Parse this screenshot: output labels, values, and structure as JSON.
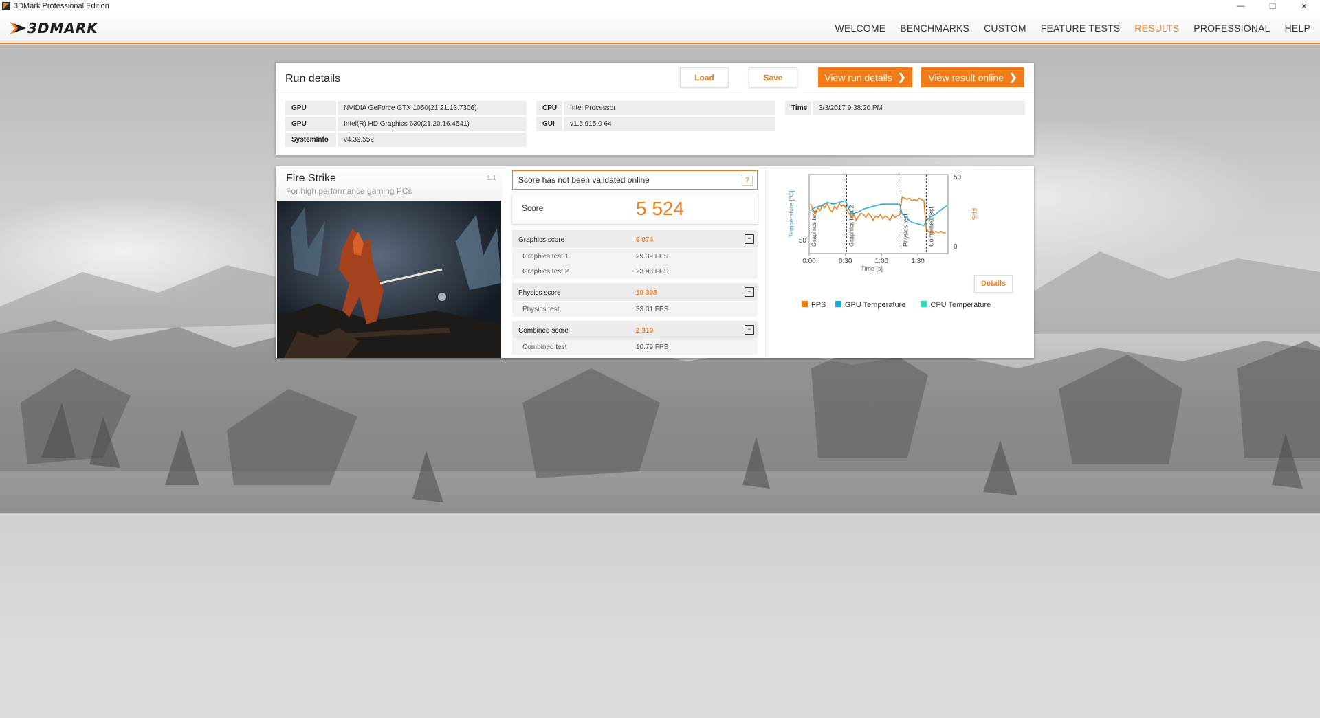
{
  "window": {
    "title": "3DMark Professional Edition",
    "minimize": "—",
    "restore": "❐",
    "close": "✕"
  },
  "nav": {
    "logo": "3DMARK",
    "items": [
      {
        "label": "WELCOME",
        "active": false
      },
      {
        "label": "BENCHMARKS",
        "active": false
      },
      {
        "label": "CUSTOM",
        "active": false
      },
      {
        "label": "FEATURE TESTS",
        "active": false
      },
      {
        "label": "RESULTS",
        "active": true
      },
      {
        "label": "PROFESSIONAL",
        "active": false
      },
      {
        "label": "HELP",
        "active": false
      }
    ]
  },
  "run_details": {
    "title": "Run details",
    "load_label": "Load",
    "save_label": "Save",
    "view_run_label": "View run details",
    "view_online_label": "View result online",
    "chevron": "❯",
    "gpu_key": "GPU",
    "gpu1": "NVIDIA GeForce GTX 1050(21.21.13.7306)",
    "gpu2": "Intel(R) HD Graphics 630(21.20.16.4541)",
    "sysinfo_key": "SystemInfo",
    "sysinfo": "v4.39.552",
    "cpu_key": "CPU",
    "cpu": "Intel Processor",
    "gui_key": "GUI",
    "gui": "v1.5.915.0 64",
    "time_key": "Time",
    "time": "3/3/2017 9:38:20 PM"
  },
  "benchmark": {
    "name": "Fire Strike",
    "subtitle": "For high performance gaming PCs",
    "version": "1.1",
    "validation": "Score has not been validated online",
    "help": "?",
    "score_label": "Score",
    "score": "5 524",
    "toggle": "−",
    "graphics_label": "Graphics score",
    "graphics_score": "6 074",
    "gt1_label": "Graphics test 1",
    "gt1_value": "29.39 FPS",
    "gt2_label": "Graphics test 2",
    "gt2_value": "23.98 FPS",
    "physics_label": "Physics score",
    "physics_score": "10 398",
    "pt_label": "Physics test",
    "pt_value": "33.01 FPS",
    "combined_label": "Combined score",
    "combined_score": "2 319",
    "ct_label": "Combined test",
    "ct_value": "10.79 FPS"
  },
  "chart_data": {
    "type": "line",
    "xlabel": "Time [s]",
    "ylabel_left": "Temperature [°C]",
    "ylabel_right": "FPS",
    "x_ticks": [
      "0:00",
      "0:30",
      "1:00",
      "1:30"
    ],
    "y_left_ticks": [
      "50"
    ],
    "y_right_ticks": [
      "50",
      "0"
    ],
    "xlim": [
      0,
      115
    ],
    "ylim_right": [
      -5,
      52
    ],
    "ylim_left": [
      42,
      90
    ],
    "sections": [
      {
        "label": "Graphics test",
        "start": 0,
        "end": 31
      },
      {
        "label": "Graphics test 2",
        "start": 31,
        "end": 76
      },
      {
        "label": "Physics test",
        "start": 76,
        "end": 97
      },
      {
        "label": "Combined test",
        "start": 97,
        "end": 115
      }
    ],
    "series": [
      {
        "name": "FPS",
        "color": "#f07d1a",
        "points": [
          [
            1,
            31
          ],
          [
            3,
            27
          ],
          [
            5,
            23
          ],
          [
            7,
            28
          ],
          [
            9,
            26
          ],
          [
            11,
            30
          ],
          [
            13,
            28
          ],
          [
            15,
            31
          ],
          [
            17,
            27
          ],
          [
            19,
            25
          ],
          [
            21,
            29
          ],
          [
            23,
            27
          ],
          [
            25,
            31
          ],
          [
            27,
            29
          ],
          [
            29,
            30
          ],
          [
            31,
            27
          ],
          [
            33,
            24
          ],
          [
            35,
            21
          ],
          [
            37,
            23
          ],
          [
            39,
            19
          ],
          [
            41,
            22
          ],
          [
            43,
            24
          ],
          [
            45,
            23
          ],
          [
            47,
            21
          ],
          [
            49,
            24
          ],
          [
            51,
            22
          ],
          [
            53,
            19
          ],
          [
            55,
            22
          ],
          [
            57,
            21
          ],
          [
            59,
            23
          ],
          [
            61,
            20
          ],
          [
            63,
            22
          ],
          [
            65,
            21
          ],
          [
            67,
            19
          ],
          [
            69,
            23
          ],
          [
            71,
            21
          ],
          [
            73,
            22
          ],
          [
            75,
            23
          ],
          [
            77,
            36
          ],
          [
            79,
            35
          ],
          [
            81,
            34
          ],
          [
            83,
            35
          ],
          [
            85,
            33
          ],
          [
            87,
            34
          ],
          [
            89,
            33
          ],
          [
            91,
            35
          ],
          [
            93,
            34
          ],
          [
            95,
            33
          ],
          [
            97,
            12
          ],
          [
            99,
            11
          ],
          [
            101,
            11
          ],
          [
            103,
            10
          ],
          [
            105,
            11
          ],
          [
            107,
            10
          ],
          [
            109,
            11
          ],
          [
            111,
            10
          ],
          [
            113,
            10
          ]
        ]
      },
      {
        "name": "GPU Temperature",
        "color": "#1ea7e1",
        "points": [
          [
            1,
            68
          ],
          [
            5,
            70
          ],
          [
            10,
            71
          ],
          [
            15,
            73
          ],
          [
            20,
            72
          ],
          [
            25,
            73
          ],
          [
            30,
            74
          ],
          [
            35,
            66
          ],
          [
            40,
            67
          ],
          [
            45,
            69
          ],
          [
            50,
            70
          ],
          [
            55,
            71
          ],
          [
            60,
            72
          ],
          [
            65,
            72
          ],
          [
            70,
            72
          ],
          [
            75,
            72
          ],
          [
            77,
            66
          ],
          [
            80,
            64
          ],
          [
            85,
            61
          ],
          [
            90,
            60
          ],
          [
            95,
            59
          ],
          [
            97,
            62
          ],
          [
            100,
            64
          ],
          [
            105,
            66
          ],
          [
            110,
            69
          ],
          [
            114,
            71
          ]
        ]
      },
      {
        "name": "CPU Temperature",
        "color": "#2bd9b0",
        "points": []
      }
    ]
  },
  "details_label": "Details"
}
